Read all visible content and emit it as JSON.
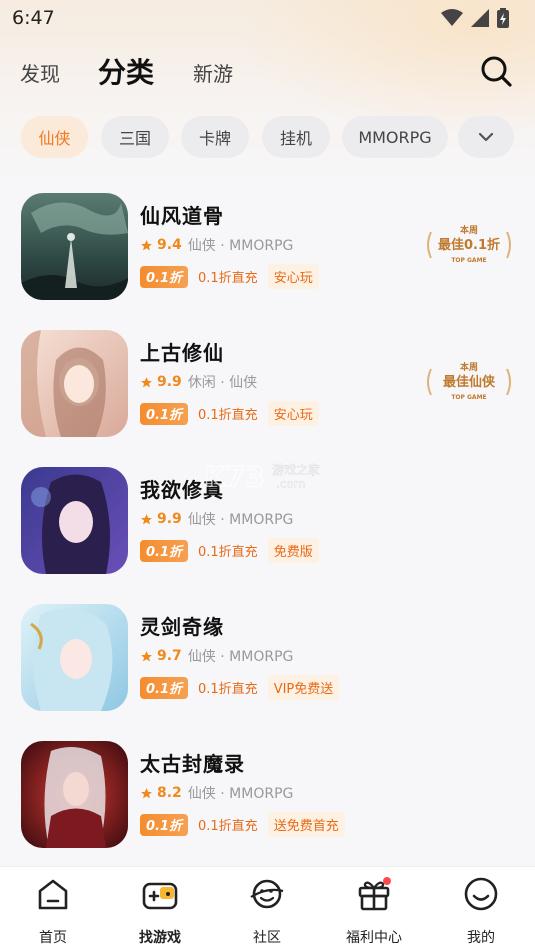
{
  "status_bar": {
    "time": "6:47"
  },
  "nav": {
    "tabs": [
      {
        "label": "发现"
      },
      {
        "label": "分类"
      },
      {
        "label": "新游"
      }
    ]
  },
  "chips": [
    "仙侠",
    "三国",
    "卡牌",
    "挂机",
    "MMORPG"
  ],
  "games": [
    {
      "title": "仙风道骨",
      "score": "9.4",
      "meta": "仙侠 · MMORPG",
      "discount": "0.1折",
      "discount_text": "0.1折直充",
      "tag": "安心玩",
      "award": {
        "line1": "本周",
        "line2": "最佳0.1折",
        "line3": "TOP GAME"
      }
    },
    {
      "title": "上古修仙",
      "score": "9.9",
      "meta": "休闲 · 仙侠",
      "discount": "0.1折",
      "discount_text": "0.1折直充",
      "tag": "安心玩",
      "award": {
        "line1": "本周",
        "line2": "最佳仙侠",
        "line3": "TOP GAME"
      }
    },
    {
      "title": "我欲修真",
      "score": "9.9",
      "meta": "仙侠 · MMORPG",
      "discount": "0.1折",
      "discount_text": "0.1折直充",
      "tag": "免费版"
    },
    {
      "title": "灵剑奇缘",
      "score": "9.7",
      "meta": "仙侠 · MMORPG",
      "discount": "0.1折",
      "discount_text": "0.1折直充",
      "tag": "VIP免费送"
    },
    {
      "title": "太古封魔录",
      "score": "8.2",
      "meta": "仙侠 · MMORPG",
      "discount": "0.1折",
      "discount_text": "0.1折直充",
      "tag": "送免费首充"
    }
  ],
  "watermark": {
    "brand": "K73",
    "line1": "游戏之家",
    "line2": ".com"
  },
  "bottom_nav": [
    {
      "label": "首页"
    },
    {
      "label": "找游戏"
    },
    {
      "label": "社区"
    },
    {
      "label": "福利中心"
    },
    {
      "label": "我的"
    }
  ],
  "colors": {
    "accent": "#f07a22",
    "badge": "#f58c2e",
    "score": "#f08a1c"
  }
}
